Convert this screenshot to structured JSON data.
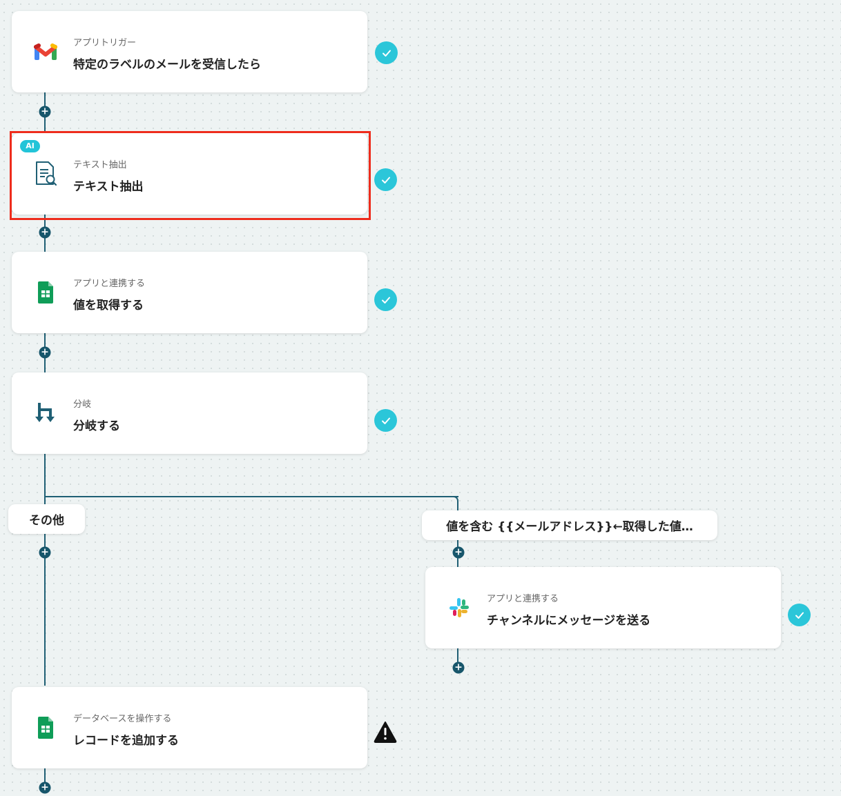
{
  "steps": [
    {
      "sub": "アプリトリガー",
      "title": "特定のラベルのメールを受信したら",
      "icon": "gmail-icon",
      "status": "complete"
    },
    {
      "sub": "テキスト抽出",
      "title": "テキスト抽出",
      "icon": "document-search-icon",
      "badge": "AI",
      "status": "complete",
      "selected": true
    },
    {
      "sub": "アプリと連携する",
      "title": "値を取得する",
      "icon": "google-sheets-icon",
      "status": "complete"
    },
    {
      "sub": "分岐",
      "title": "分岐する",
      "icon": "branch-icon",
      "status": "complete"
    },
    {
      "sub": "アプリと連携する",
      "title": "チャンネルにメッセージを送る",
      "icon": "slack-icon",
      "status": "complete"
    },
    {
      "sub": "データベースを操作する",
      "title": "レコードを追加する",
      "icon": "google-sheets-icon",
      "status": "warning"
    }
  ],
  "branches": {
    "other_label": "その他",
    "condition_label": "値を含む {{メールアドレス}}←取得した値…"
  },
  "colors": {
    "connector": "#1f5f74",
    "check": "#2bc6d9",
    "highlight": "#ee2c1c",
    "ai_badge": "#22c4d8"
  }
}
